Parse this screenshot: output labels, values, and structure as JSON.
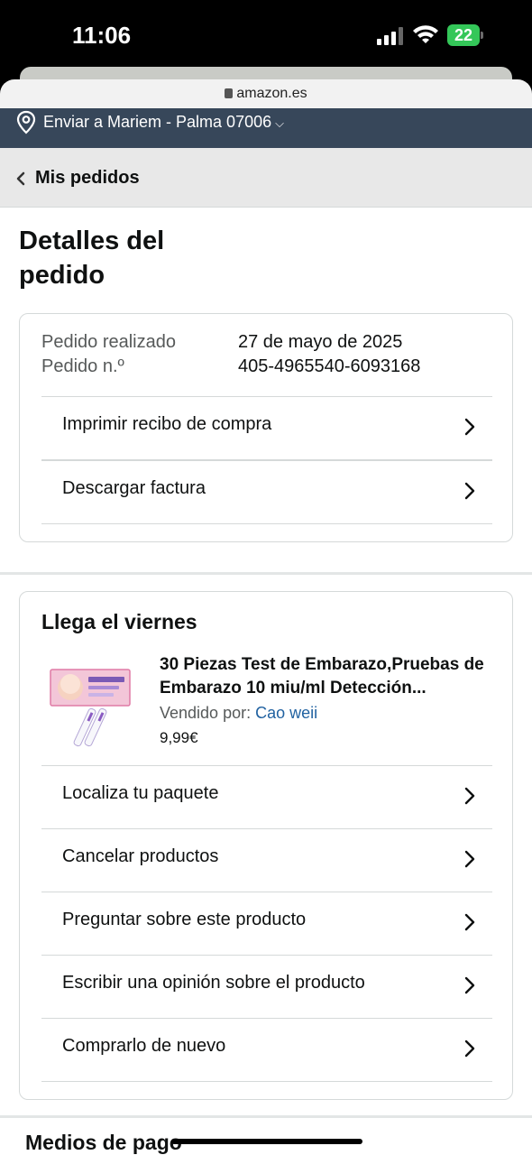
{
  "status_bar": {
    "time": "11:06",
    "battery": "22"
  },
  "browser": {
    "url": "amazon.es"
  },
  "deliver_bar": {
    "text": "Enviar a Mariem - Palma 07006",
    "chevron": "⌵"
  },
  "breadcrumb": {
    "back_label": "Mis pedidos"
  },
  "page": {
    "title": "Detalles del pedido"
  },
  "order_card": {
    "placed_label": "Pedido realizado",
    "placed_value": "27 de mayo de 2025",
    "number_label": "Pedido n.º",
    "number_value": "405-4965540-6093168",
    "actions": [
      "Imprimir recibo de compra",
      "Descargar factura"
    ]
  },
  "shipment_card": {
    "heading": "Llega el viernes",
    "product": {
      "name": "30 Piezas Test de Embarazo,Pruebas de Embarazo 10 miu/ml Detección...",
      "sold_by_label": "Vendido por:",
      "seller": "Cao weii",
      "price": "9,99€"
    },
    "actions": [
      "Localiza tu paquete",
      "Cancelar productos",
      "Preguntar sobre este producto",
      "Escribir una opinión sobre el producto",
      "Comprarlo de nuevo"
    ]
  },
  "payment_section": {
    "heading": "Medios de pago"
  },
  "icons": [
    "location-pin-icon",
    "chevron-left-icon",
    "chevron-right-icon",
    "lock-icon",
    "signal-icon",
    "wifi-icon",
    "battery-icon"
  ],
  "colors": {
    "nav_bar": "#37475a",
    "link": "#2162a1",
    "battery": "#34c759"
  }
}
